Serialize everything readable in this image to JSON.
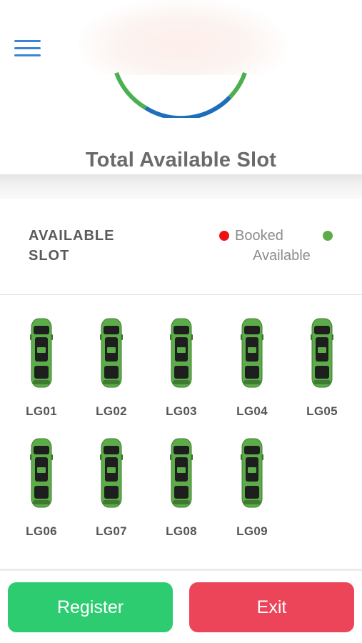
{
  "header": {
    "menu_icon": "hamburger-menu-icon"
  },
  "gauge": {
    "colors": {
      "primary_arc": "#1e6fba",
      "secondary_arc": "#4caf50"
    }
  },
  "summary": {
    "title": "Total Available Slot"
  },
  "slots_section": {
    "title": "AVAILABLE SLOT",
    "legend": [
      {
        "label": "Booked",
        "color": "#ee1111"
      },
      {
        "label": "Available",
        "color": "#5cad4a"
      }
    ],
    "slots": [
      {
        "label": "LG01",
        "status": "available",
        "icon": "car-icon"
      },
      {
        "label": "LG02",
        "status": "available",
        "icon": "car-icon"
      },
      {
        "label": "LG03",
        "status": "available",
        "icon": "car-icon"
      },
      {
        "label": "LG04",
        "status": "available",
        "icon": "car-icon"
      },
      {
        "label": "LG05",
        "status": "available",
        "icon": "car-icon"
      },
      {
        "label": "LG06",
        "status": "available",
        "icon": "car-icon"
      },
      {
        "label": "LG07",
        "status": "available",
        "icon": "car-icon"
      },
      {
        "label": "LG08",
        "status": "available",
        "icon": "car-icon"
      },
      {
        "label": "LG09",
        "status": "available",
        "icon": "car-icon"
      }
    ]
  },
  "actions": {
    "register_label": "Register",
    "exit_label": "Exit",
    "colors": {
      "register": "#2ecc71",
      "exit": "#ec4459"
    }
  }
}
